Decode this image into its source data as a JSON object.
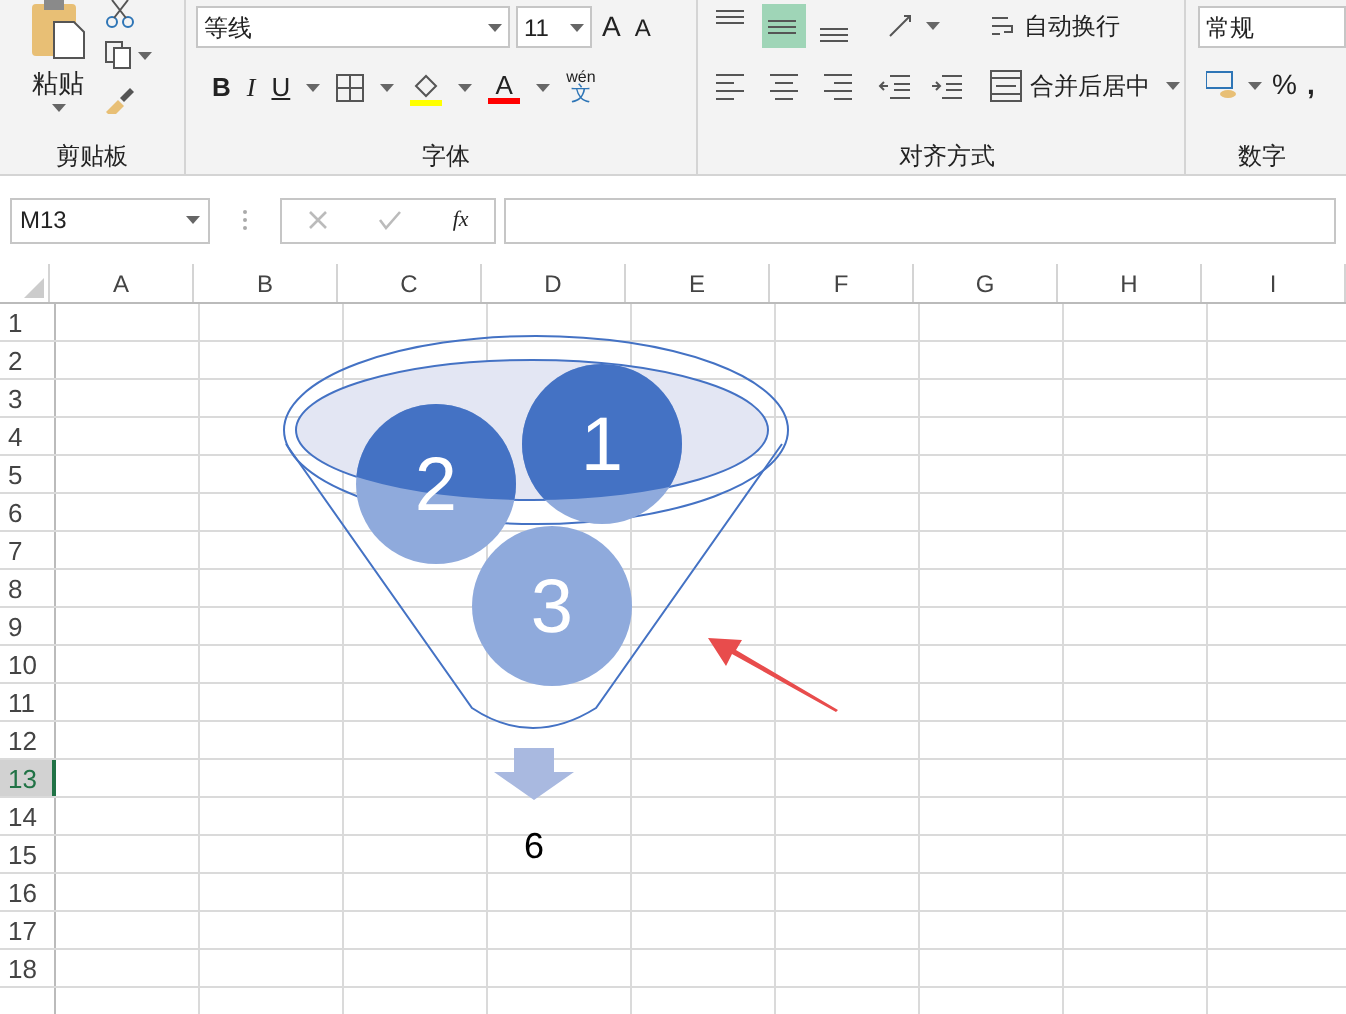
{
  "ribbon": {
    "clipboard": {
      "paste_label": "粘贴",
      "group_label": "剪贴板"
    },
    "font": {
      "font_name": "等线",
      "font_size": "11",
      "grow_label": "A",
      "shrink_label": "A",
      "bold": "B",
      "italic": "I",
      "underline": "U",
      "font_color_label": "A",
      "phonetic_top": "wén",
      "phonetic_bottom": "文",
      "group_label": "字体"
    },
    "alignment": {
      "vertical_buttons": [
        {
          "kind": "top",
          "selected": false
        },
        {
          "kind": "middle",
          "selected": true
        },
        {
          "kind": "bottom",
          "selected": false
        }
      ],
      "horizontal_buttons": [
        {
          "kind": "left",
          "selected": false
        },
        {
          "kind": "center",
          "selected": false
        },
        {
          "kind": "right",
          "selected": false
        }
      ],
      "wrap_text": "自动换行",
      "merge_center": "合并后居中",
      "group_label": "对齐方式"
    },
    "number": {
      "format": "常规",
      "percent": "%",
      "comma": ",",
      "group_label": "数字"
    }
  },
  "formula_bar": {
    "name_box": "M13",
    "fx": "fx"
  },
  "sheet": {
    "columns": [
      "A",
      "B",
      "C",
      "D",
      "E",
      "F",
      "G",
      "H",
      "I"
    ],
    "rows": [
      {
        "label": "1",
        "selected": false
      },
      {
        "label": "2",
        "selected": false
      },
      {
        "label": "3",
        "selected": false
      },
      {
        "label": "4",
        "selected": false
      },
      {
        "label": "5",
        "selected": false
      },
      {
        "label": "6",
        "selected": false
      },
      {
        "label": "7",
        "selected": false
      },
      {
        "label": "8",
        "selected": false
      },
      {
        "label": "9",
        "selected": false
      },
      {
        "label": "10",
        "selected": false
      },
      {
        "label": "11",
        "selected": false
      },
      {
        "label": "12",
        "selected": false
      },
      {
        "label": "13",
        "selected": true
      },
      {
        "label": "14",
        "selected": false
      },
      {
        "label": "15",
        "selected": false
      },
      {
        "label": "16",
        "selected": false
      },
      {
        "label": "17",
        "selected": false
      },
      {
        "label": "18",
        "selected": false
      }
    ]
  },
  "funnel_diagram": {
    "circles": [
      {
        "label": "1"
      },
      {
        "label": "2"
      },
      {
        "label": "3"
      }
    ],
    "result": "6"
  }
}
